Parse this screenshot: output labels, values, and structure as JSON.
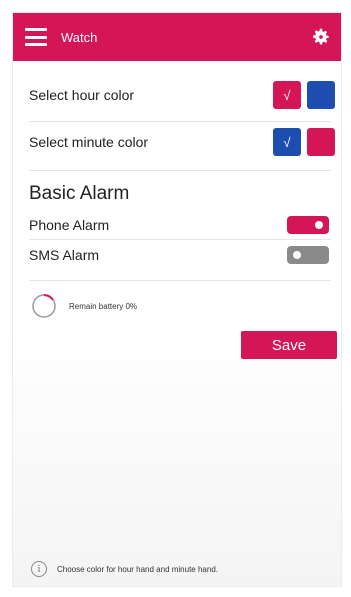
{
  "app": {
    "title": "Watch",
    "menu_icon": "hamburger-menu-icon",
    "settings_icon": "gear-icon",
    "accent_color": "#d41556",
    "blue_color": "#1e4db0"
  },
  "colors": {
    "hour": {
      "label": "Select hour color",
      "options": [
        {
          "color": "pink",
          "selected": true,
          "mark": "√"
        },
        {
          "color": "blue",
          "selected": false,
          "mark": ""
        }
      ]
    },
    "minute": {
      "label": "Select minute color",
      "options": [
        {
          "color": "blue",
          "selected": true,
          "mark": "√"
        },
        {
          "color": "pink",
          "selected": false,
          "mark": ""
        }
      ]
    }
  },
  "alarm": {
    "title": "Basic Alarm",
    "phone": {
      "label": "Phone Alarm",
      "on": true
    },
    "sms": {
      "label": "SMS Alarm",
      "on": false
    }
  },
  "battery": {
    "text": "Remain battery 0%",
    "level": 0
  },
  "actions": {
    "save_label": "Save"
  },
  "footer": {
    "info_glyph": "i",
    "hint": "Choose color for hour hand and minute hand."
  }
}
